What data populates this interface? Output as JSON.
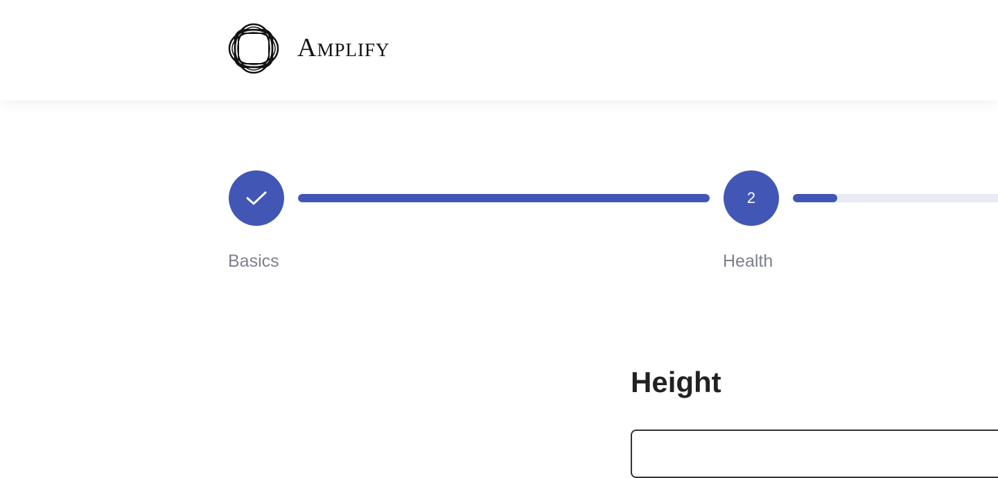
{
  "brand": {
    "name": "Amplify",
    "logo_icon": "interlocking-rings-logo"
  },
  "stepper": {
    "steps": [
      {
        "label": "Basics",
        "state": "complete",
        "icon": "checkmark-icon",
        "connector_progress": 1.0
      },
      {
        "label": "Health",
        "state": "current",
        "number": "2",
        "connector_progress": 0.2
      }
    ],
    "colors": {
      "active": "#4256b5",
      "track": "#e8ebf6",
      "label": "#7d7f8c"
    }
  },
  "form": {
    "section_title": "Height",
    "height_value": ""
  }
}
